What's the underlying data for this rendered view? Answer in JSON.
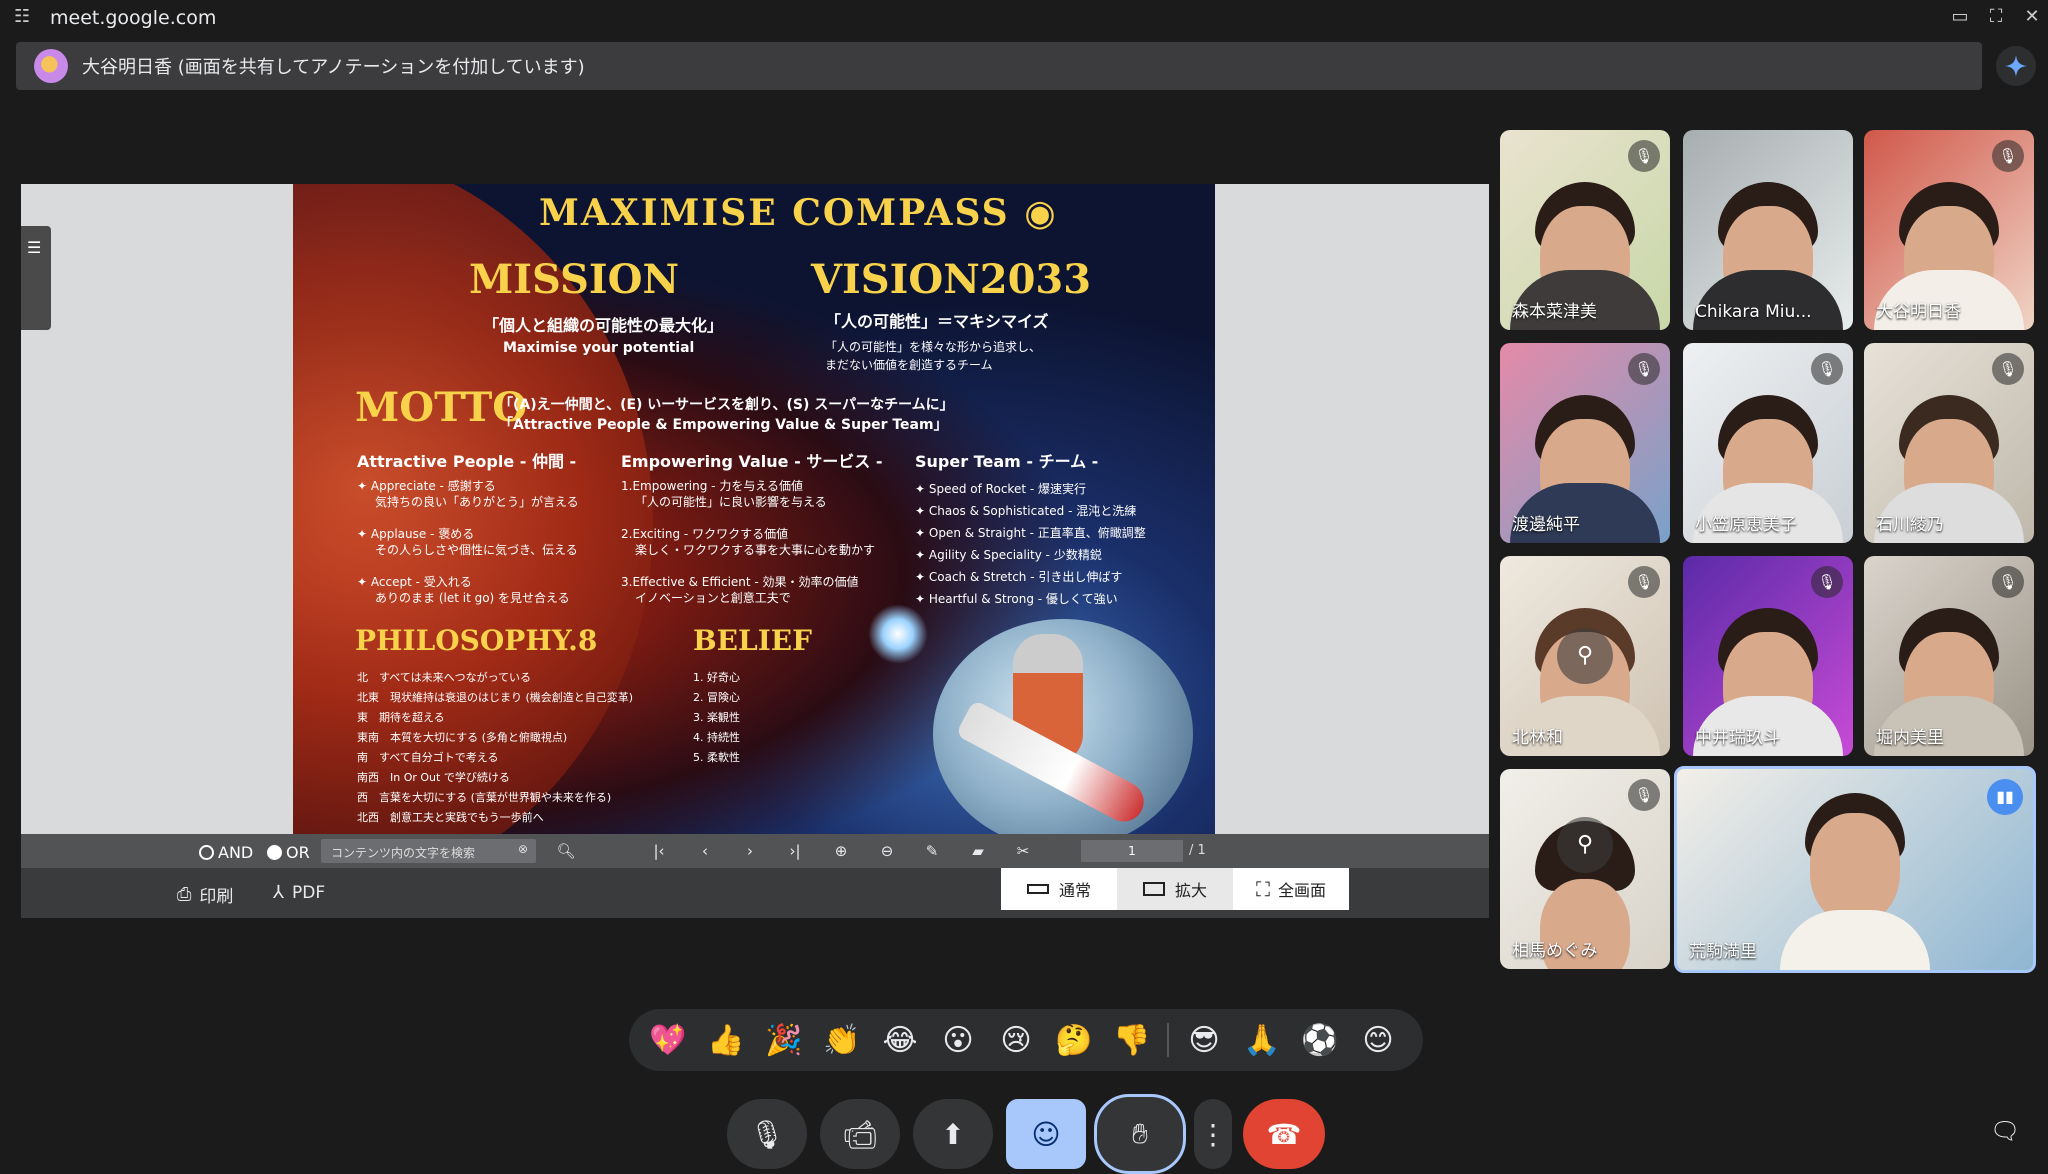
{
  "browser": {
    "url": "meet.google.com"
  },
  "share_banner": {
    "text": "大谷明日香 (画面を共有してアノテーションを付加しています)"
  },
  "slide": {
    "title": "MAXIMISE COMPASS ◉",
    "mission_heading": "MISSION",
    "mission_jp": "「個人と組織の可能性の最大化」",
    "mission_en": "Maximise your potential",
    "vision_heading": "VISION2033",
    "vision_jp": "「人の可能性」＝マキシマイズ",
    "vision_desc1": "「人の可能性」を様々な形から追求し、",
    "vision_desc2": "まだない価値を創造するチーム",
    "motto_heading": "MOTTO",
    "motto_line1": "「(A)え一仲間と、(E) いーサービスを創り、(S) スーパーなチームに」",
    "motto_line2": "「Attractive People & Empowering Value & Super Team」",
    "col1_head": "Attractive People - 仲間 -",
    "col1_items": [
      "✦ Appreciate - 感謝する",
      "気持ちの良い「ありがとう」が言える",
      "✦ Applause - 褒める",
      "その人らしさや個性に気づき、伝える",
      "✦ Accept - 受入れる",
      "ありのまま (let it go) を見せ合える"
    ],
    "col2_head": "Empowering Value - サービス -",
    "col2_items": [
      "1.Empowering - 力を与える価値",
      "「人の可能性」に良い影響を与える",
      "2.Exciting - ワクワクする価値",
      "楽しく・ワクワクする事を大事に心を動かす",
      "3.Effective & Efficient - 効果・効率の価値",
      "イノベーションと創意工夫で"
    ],
    "col3_head": "Super Team - チーム -",
    "col3_items": [
      "✦ Speed of Rocket - 爆速実行",
      "✦ Chaos & Sophisticated - 混沌と洗練",
      "✦ Open & Straight - 正直率直、俯瞰調整",
      "✦ Agility & Speciality - 少数精鋭",
      "✦ Coach & Stretch - 引き出し伸ばす",
      "✦ Heartful & Strong - 優しくて強い"
    ],
    "philosophy_heading": "PHILOSOPHY.8",
    "philosophy_items": [
      "北　すべては未来へつながっている",
      "北東　現状維持は衰退のはじまり (機会創造と自己変革)",
      "東　期待を超える",
      "東南　本質を大切にする (多角と俯瞰視点)",
      "南　すべて自分ゴトで考える",
      "南西　In Or Out で学び続ける",
      "西　言葉を大切にする (言葉が世界観や未来を作る)",
      "北西　創意工夫と実践でもう一歩前へ"
    ],
    "belief_heading": "BELIEF",
    "belief_items": [
      "1. 好奇心",
      "2. 冒険心",
      "3. 楽観性",
      "4. 持続性",
      "5. 柔軟性"
    ]
  },
  "viewer": {
    "and_label": "AND",
    "or_label": "OR",
    "search_placeholder": "コンテンツ内の文字を検索",
    "page_current": "1",
    "page_total": "/ 1",
    "print_label": "印刷",
    "pdf_label": "PDF",
    "view_normal": "通常",
    "view_zoom": "拡大",
    "view_full": "全画面"
  },
  "participants": [
    {
      "name": "森本菜津美",
      "muted": true
    },
    {
      "name": "Chikara Miu...",
      "muted": false
    },
    {
      "name": "大谷明日香",
      "muted": true
    },
    {
      "name": "渡邊純平",
      "muted": true
    },
    {
      "name": "小笠原恵美子",
      "muted": true
    },
    {
      "name": "石川綾乃",
      "muted": true
    },
    {
      "name": "北林和",
      "muted": true
    },
    {
      "name": "中井瑞玖斗",
      "muted": true
    },
    {
      "name": "堀内美里",
      "muted": true
    },
    {
      "name": "相馬めぐみ",
      "muted": true
    },
    {
      "name": "荒駒満里",
      "muted": false,
      "speaking": true
    }
  ],
  "reactions": [
    "💖",
    "👍",
    "🎉",
    "👏",
    "😂",
    "😮",
    "😢",
    "🤔",
    "👎",
    "😎",
    "🙏",
    "⚽",
    "😊"
  ],
  "controls": [
    "mic-icon",
    "camera-icon",
    "present-icon",
    "emoji-icon",
    "raise-hand-icon",
    "more-icon",
    "end-call-icon"
  ]
}
